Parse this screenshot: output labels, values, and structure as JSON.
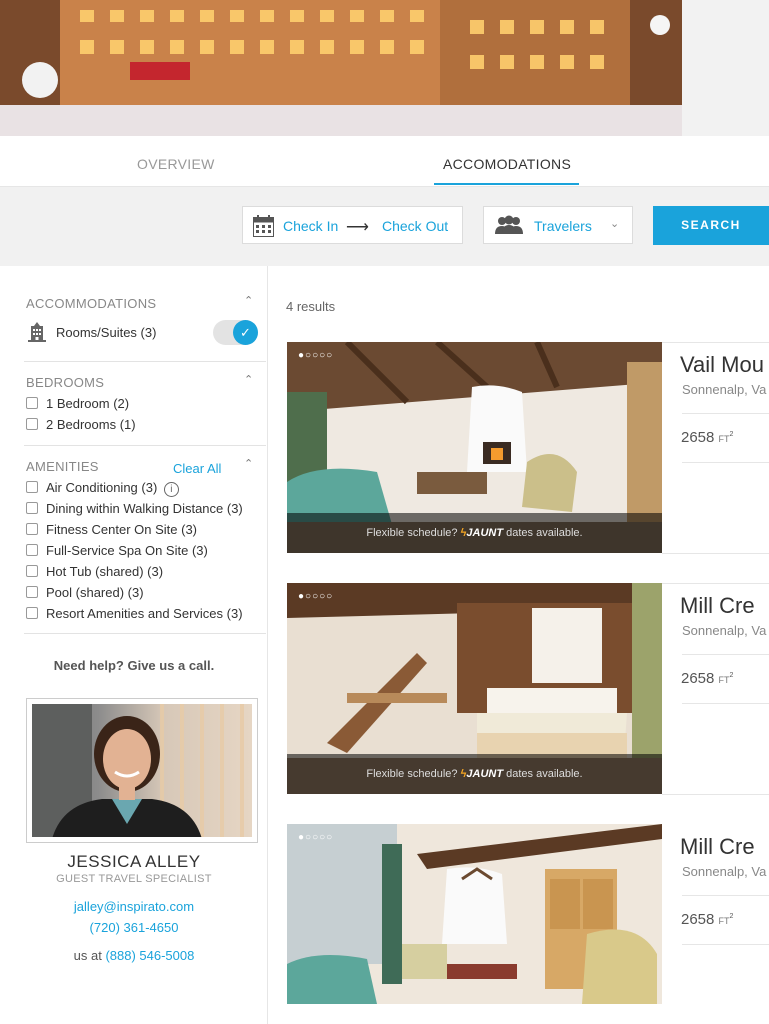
{
  "tabs": {
    "overview": "OVERVIEW",
    "accommodations": "ACCOMODATIONS"
  },
  "search": {
    "check_in": "Check In",
    "arrow": "⟶",
    "check_out": "Check Out",
    "travelers": "Travelers",
    "button": "SEARCH"
  },
  "filters": {
    "accommodations": {
      "title": "ACCOMMODATIONS",
      "item": "Rooms/Suites (3)",
      "toggle_on": true
    },
    "bedrooms": {
      "title": "BEDROOMS",
      "items": [
        "1 Bedroom (2)",
        "2 Bedrooms (1)"
      ]
    },
    "amenities": {
      "title": "AMENITIES",
      "clear": "Clear All",
      "items": [
        "Air Conditioning (3)",
        "Dining within Walking Distance (3)",
        "Fitness Center On Site (3)",
        "Full-Service Spa On Site (3)",
        "Hot Tub (shared) (3)",
        "Pool (shared) (3)",
        "Resort Amenities and Services (3)"
      ]
    }
  },
  "help": {
    "heading": "Need help? Give us a call.",
    "name": "JESSICA ALLEY",
    "role": "GUEST TRAVEL SPECIALIST",
    "email": "jalley@inspirato.com",
    "phone": "(720) 361-4650",
    "us_prefix": "us at",
    "us_phone": "(888) 546-5008"
  },
  "results": {
    "count": "4 results",
    "jaunt_prefix": "Flexible schedule?",
    "jaunt_brand": "JAUNT",
    "jaunt_suffix": "dates available.",
    "cards": [
      {
        "title": "Vail Mou",
        "location": "Sonnenalp, Va",
        "sqft": "2658",
        "unit": "FT",
        "sup": "2"
      },
      {
        "title": "Mill Cre",
        "location": "Sonnenalp, Va",
        "sqft": "2658",
        "unit": "FT",
        "sup": "2"
      },
      {
        "title": "Mill Cre",
        "location": "Sonnenalp, Va",
        "sqft": "2658",
        "unit": "FT",
        "sup": "2"
      }
    ]
  }
}
